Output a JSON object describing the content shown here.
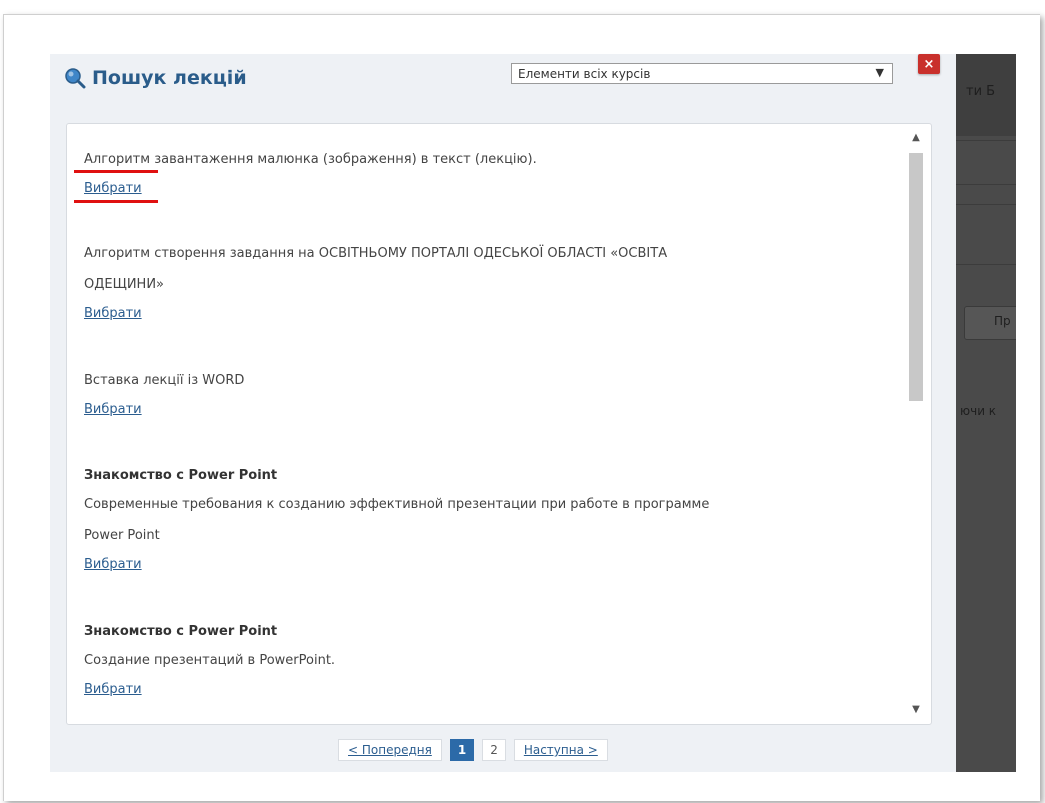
{
  "dialog": {
    "title": "Пошук лекцій",
    "course_filter": {
      "selected": "Елементи всіх курсів"
    },
    "close_label": "×"
  },
  "results": [
    {
      "title": "",
      "text_lines": [
        "Алгоритм завантаження малюнка (зображення) в текст (лекцію)."
      ],
      "link": "Вибрати"
    },
    {
      "title": "",
      "text_lines": [
        "Алгоритм створення завдання на ОСВІТНЬОМУ ПОРТАЛІ ОДЕСЬКОЇ ОБЛАСТІ «ОСВІТА",
        "ОДЕЩИНИ»"
      ],
      "link": "Вибрати"
    },
    {
      "title": "",
      "text_lines": [
        "Вставка лекції із WORD"
      ],
      "link": "Вибрати"
    },
    {
      "title": "Знакомство с Power Point",
      "text_lines": [
        "Современные требования к созданию эффективной презентации при работе в программе",
        "Power Point"
      ],
      "link": "Вибрати"
    },
    {
      "title": "Знакомство с Power Point",
      "text_lines": [
        "Создание презентаций в PowerPoint."
      ],
      "link": "Вибрати"
    }
  ],
  "pagination": {
    "prev": "< Попередня",
    "pages": [
      "1",
      "2"
    ],
    "current": "1",
    "next": "Наступна >"
  },
  "background": {
    "header_text": "ти   Б",
    "tab_text": "Пр",
    "body_text": "ючи к"
  },
  "colors": {
    "accent": "#2a5c8a",
    "annotation": "#e01010",
    "close": "#c9302c"
  }
}
